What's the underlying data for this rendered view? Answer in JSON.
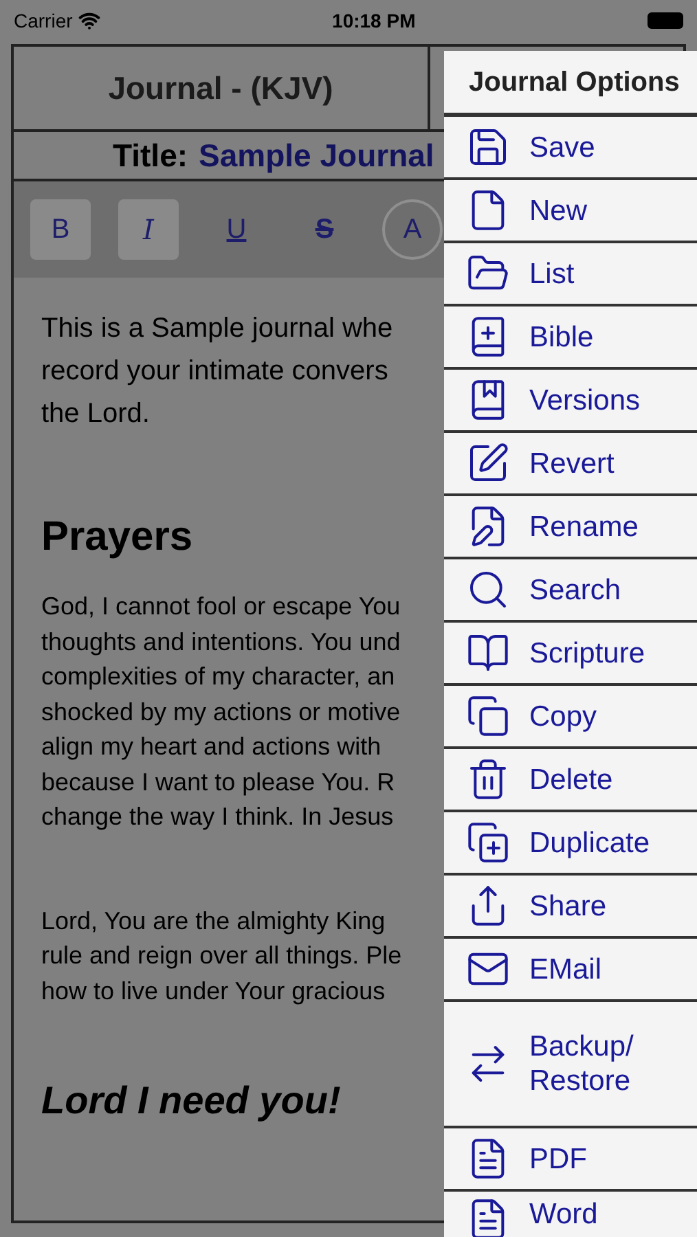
{
  "status_bar": {
    "carrier": "Carrier",
    "time": "10:18 PM"
  },
  "header": {
    "title": "Journal - (KJV)"
  },
  "title_row": {
    "label": "Title:",
    "value": "Sample Journal"
  },
  "format_toolbar": [
    {
      "label": "B",
      "kind": "bold",
      "selected": true
    },
    {
      "label": "I",
      "kind": "italic",
      "selected": true
    },
    {
      "label": "U",
      "kind": "underline",
      "selected": false
    },
    {
      "label": "S",
      "kind": "strike",
      "selected": false
    },
    {
      "label": "A",
      "kind": "circle",
      "selected": false
    }
  ],
  "content": [
    {
      "kind": "large",
      "lines": [
        "This is a Sample journal whe",
        "record your intimate convers",
        "the Lord."
      ]
    },
    {
      "kind": "heading",
      "lines": [
        "Prayers"
      ]
    },
    {
      "kind": "body",
      "lines": [
        "God, I cannot fool or escape You",
        "thoughts and intentions. You und",
        "complexities of my character, an",
        "shocked by my actions or motive",
        "align my heart and actions with",
        "because I want to please You. R",
        "change the way I think. In Jesus"
      ]
    },
    {
      "kind": "body",
      "lines": [
        "Lord, You are the almighty King",
        "rule and reign over all things. Ple",
        "how to live under Your gracious"
      ]
    },
    {
      "kind": "emphasis",
      "lines": [
        "Lord I need you!"
      ]
    }
  ],
  "menu": {
    "title": "Journal Options",
    "items": [
      {
        "label": "Save"
      },
      {
        "label": "New"
      },
      {
        "label": "List"
      },
      {
        "label": "Bible"
      },
      {
        "label": "Versions"
      },
      {
        "label": "Revert"
      },
      {
        "label": "Rename"
      },
      {
        "label": "Search"
      },
      {
        "label": "Scripture"
      },
      {
        "label": "Copy"
      },
      {
        "label": "Delete"
      },
      {
        "label": "Duplicate"
      },
      {
        "label": "Share"
      },
      {
        "label": "EMail"
      },
      {
        "label": "Backup/ Restore"
      },
      {
        "label": "PDF"
      },
      {
        "label": "Word"
      }
    ]
  }
}
